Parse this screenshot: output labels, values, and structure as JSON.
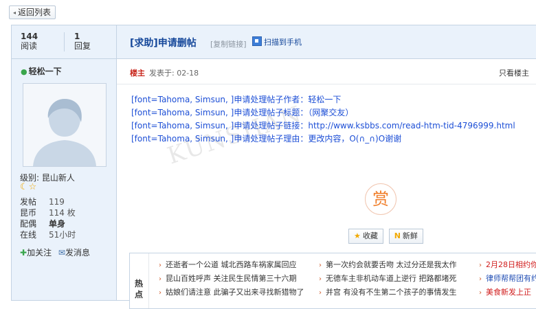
{
  "back_button": {
    "label": "返回列表"
  },
  "sidebar": {
    "reads": {
      "count": "144",
      "label": "阅读"
    },
    "replies": {
      "count": "1",
      "label": "回复"
    },
    "username": "轻松一下",
    "level_text": "级别: 昆山新人",
    "info": [
      {
        "key": "发帖",
        "value": "119"
      },
      {
        "key": "昆币",
        "value": "114 枚"
      },
      {
        "key": "配偶",
        "value": "单身"
      },
      {
        "key": "在线",
        "value": "51小时"
      }
    ],
    "follow_label": "加关注",
    "message_label": "发消息"
  },
  "thread": {
    "title": "[求助]申请删帖",
    "copy_link": "[复制链接]",
    "qr_label": "扫描到手机"
  },
  "post": {
    "op_badge": "楼主",
    "posted_at": "发表于: 02-18",
    "only_op": "只看楼主",
    "lines": [
      "[font=Tahoma, Simsun, ]申请处理帖子作者：轻松一下",
      "[font=Tahoma, Simsun, ]申请处理帖子标题：（网聚交友）",
      "[font=Tahoma, Simsun, ]申请处理帖子链接：http://www.ksbbs.com/read-htm-tid-4796999.html",
      "[font=Tahoma, Simsun, ]申请处理帖子理由：更改内容，O(∩_∩)O谢谢"
    ],
    "watermark": "KUNSHAN",
    "reward_label": "赏",
    "favorite_label": "收藏",
    "fresh_label": "新鲜"
  },
  "hot": {
    "label": "热点",
    "col1": [
      "还逝者一个公道 城北西路车祸家属回应",
      "昆山百姓呼声 关注民生民情第三十六期",
      "姑娘们请注意 此骗子又出来寻找新猎物了"
    ],
    "col2": [
      "第一次约会就要舌吻 太过分还是我太作",
      "无德车主非机动车道上逆行 把路都堵死",
      "并宫 有没有不生第二个孩子的事情发生"
    ],
    "col3": [
      "2月28日相约你",
      "律师帮帮团有约",
      "美食新发上正"
    ]
  }
}
